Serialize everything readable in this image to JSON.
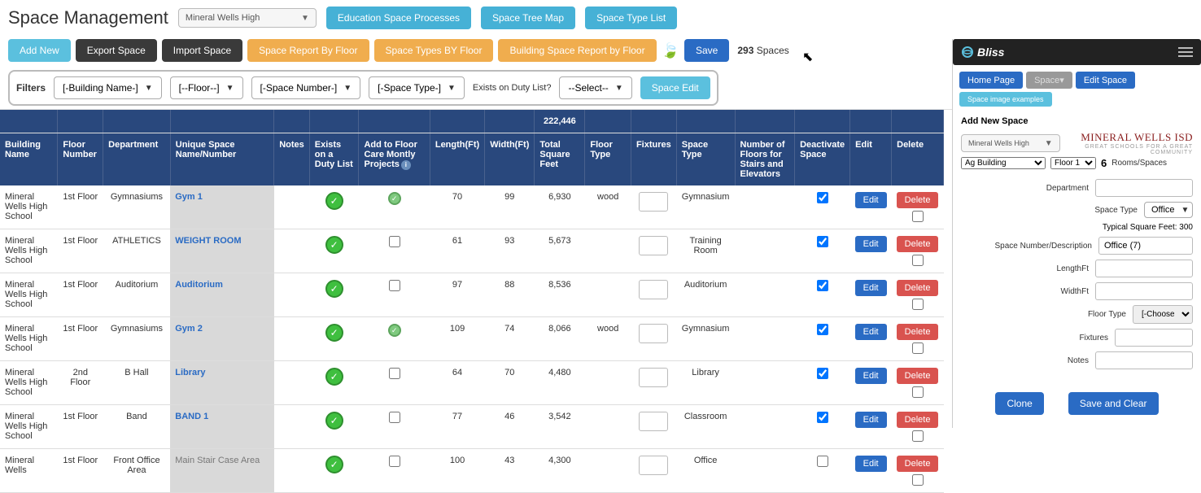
{
  "header": {
    "title": "Space Management",
    "school_select": "Mineral Wells High",
    "buttons": {
      "education_space_processes": "Education Space Processes",
      "space_tree_map": "Space Tree Map",
      "space_type_list": "Space Type List"
    }
  },
  "toolbar": {
    "add_new": "Add New",
    "export_space": "Export Space",
    "import_space": "Import Space",
    "space_report_by_floor": "Space Report By Floor",
    "space_types_by_floor": "Space Types BY Floor",
    "building_space_report_by_floor": "Building Space Report by Floor",
    "save": "Save",
    "spaces_count": "293",
    "spaces_label": "Spaces"
  },
  "filters": {
    "label": "Filters",
    "building_name": "[-Building Name-]",
    "floor": "[--Floor--]",
    "space_number": "[-Space Number-]",
    "space_type": "[-Space Type-]",
    "exists_label": "Exists on Duty List?",
    "exists_value": "--Select--",
    "space_edit": "Space Edit"
  },
  "sum_total": "222,446",
  "columns": {
    "building_name": "Building Name",
    "floor_number": "Floor Number",
    "department": "Department",
    "unique_space": "Unique Space Name/Number",
    "notes": "Notes",
    "exists_duty": "Exists on a Duty List",
    "add_floor_care": "Add to Floor Care Montly Projects",
    "length": "Length(Ft)",
    "width": "Width(Ft)",
    "total_sqft": "Total Square Feet",
    "floor_type": "Floor Type",
    "fixtures": "Fixtures",
    "space_type": "Space Type",
    "num_floors": "Number of Floors for Stairs and Elevators",
    "deactivate": "Deactivate Space",
    "edit": "Edit",
    "delete": "Delete"
  },
  "rows": [
    {
      "building": "Mineral Wells High School",
      "floor": "1st Floor",
      "dept": "Gymnasiums",
      "space": "Gym 1",
      "addfc": true,
      "len": "70",
      "wid": "99",
      "sqft": "6,930",
      "floortype": "wood",
      "spacetype": "Gymnasium",
      "deact": true
    },
    {
      "building": "Mineral Wells High School",
      "floor": "1st Floor",
      "dept": "ATHLETICS",
      "space": "WEIGHT ROOM",
      "addfc": false,
      "len": "61",
      "wid": "93",
      "sqft": "5,673",
      "floortype": "",
      "spacetype": "Training Room",
      "deact": true
    },
    {
      "building": "Mineral Wells High School",
      "floor": "1st Floor",
      "dept": "Auditorium",
      "space": "Auditorium",
      "addfc": false,
      "len": "97",
      "wid": "88",
      "sqft": "8,536",
      "floortype": "",
      "spacetype": "Auditorium",
      "deact": true
    },
    {
      "building": "Mineral Wells High School",
      "floor": "1st Floor",
      "dept": "Gymnasiums",
      "space": "Gym 2",
      "addfc": true,
      "len": "109",
      "wid": "74",
      "sqft": "8,066",
      "floortype": "wood",
      "spacetype": "Gymnasium",
      "deact": true
    },
    {
      "building": "Mineral Wells High School",
      "floor": "2nd Floor",
      "dept": "B Hall",
      "space": "Library",
      "addfc": false,
      "len": "64",
      "wid": "70",
      "sqft": "4,480",
      "floortype": "",
      "spacetype": "Library",
      "deact": true
    },
    {
      "building": "Mineral Wells High School",
      "floor": "1st Floor",
      "dept": "Band",
      "space": "BAND 1",
      "addfc": false,
      "len": "77",
      "wid": "46",
      "sqft": "3,542",
      "floortype": "",
      "spacetype": "Classroom",
      "deact": true
    },
    {
      "building": "Mineral Wells",
      "floor": "1st Floor",
      "dept": "Front Office Area",
      "space": "Main Stair Case Area",
      "addfc": false,
      "len": "100",
      "wid": "43",
      "sqft": "4,300",
      "floortype": "",
      "spacetype": "Office",
      "deact": false,
      "gray": true
    }
  ],
  "action_labels": {
    "edit": "Edit",
    "delete": "Delete"
  },
  "side": {
    "logo": "Bliss",
    "buttons": {
      "home": "Home Page",
      "space": "Space",
      "edit_space": "Edit Space",
      "examples": "Space image examples"
    },
    "add_new": "Add New Space",
    "brand": "MINERAL WELLS ISD",
    "brand_sub": "GREAT SCHOOLS FOR A GREAT COMMUNITY",
    "building_select": "Mineral Wells High",
    "ag_building": "Ag Building",
    "floor_select": "Floor 1",
    "rooms_count": "6",
    "rooms_label": "Rooms/Spaces",
    "labels": {
      "department": "Department",
      "space_type": "Space Type",
      "typical": "Typical Square Feet: 300",
      "space_number": "Space Number/Description",
      "lengthft": "LengthFt",
      "widthft": "WidthFt",
      "floor_type": "Floor Type",
      "fixtures": "Fixtures",
      "notes": "Notes"
    },
    "values": {
      "space_type": "Office",
      "space_number": "Office (7)",
      "floor_type": "[-Choose-]"
    },
    "actions": {
      "clone": "Clone",
      "save_clear": "Save and Clear"
    }
  }
}
